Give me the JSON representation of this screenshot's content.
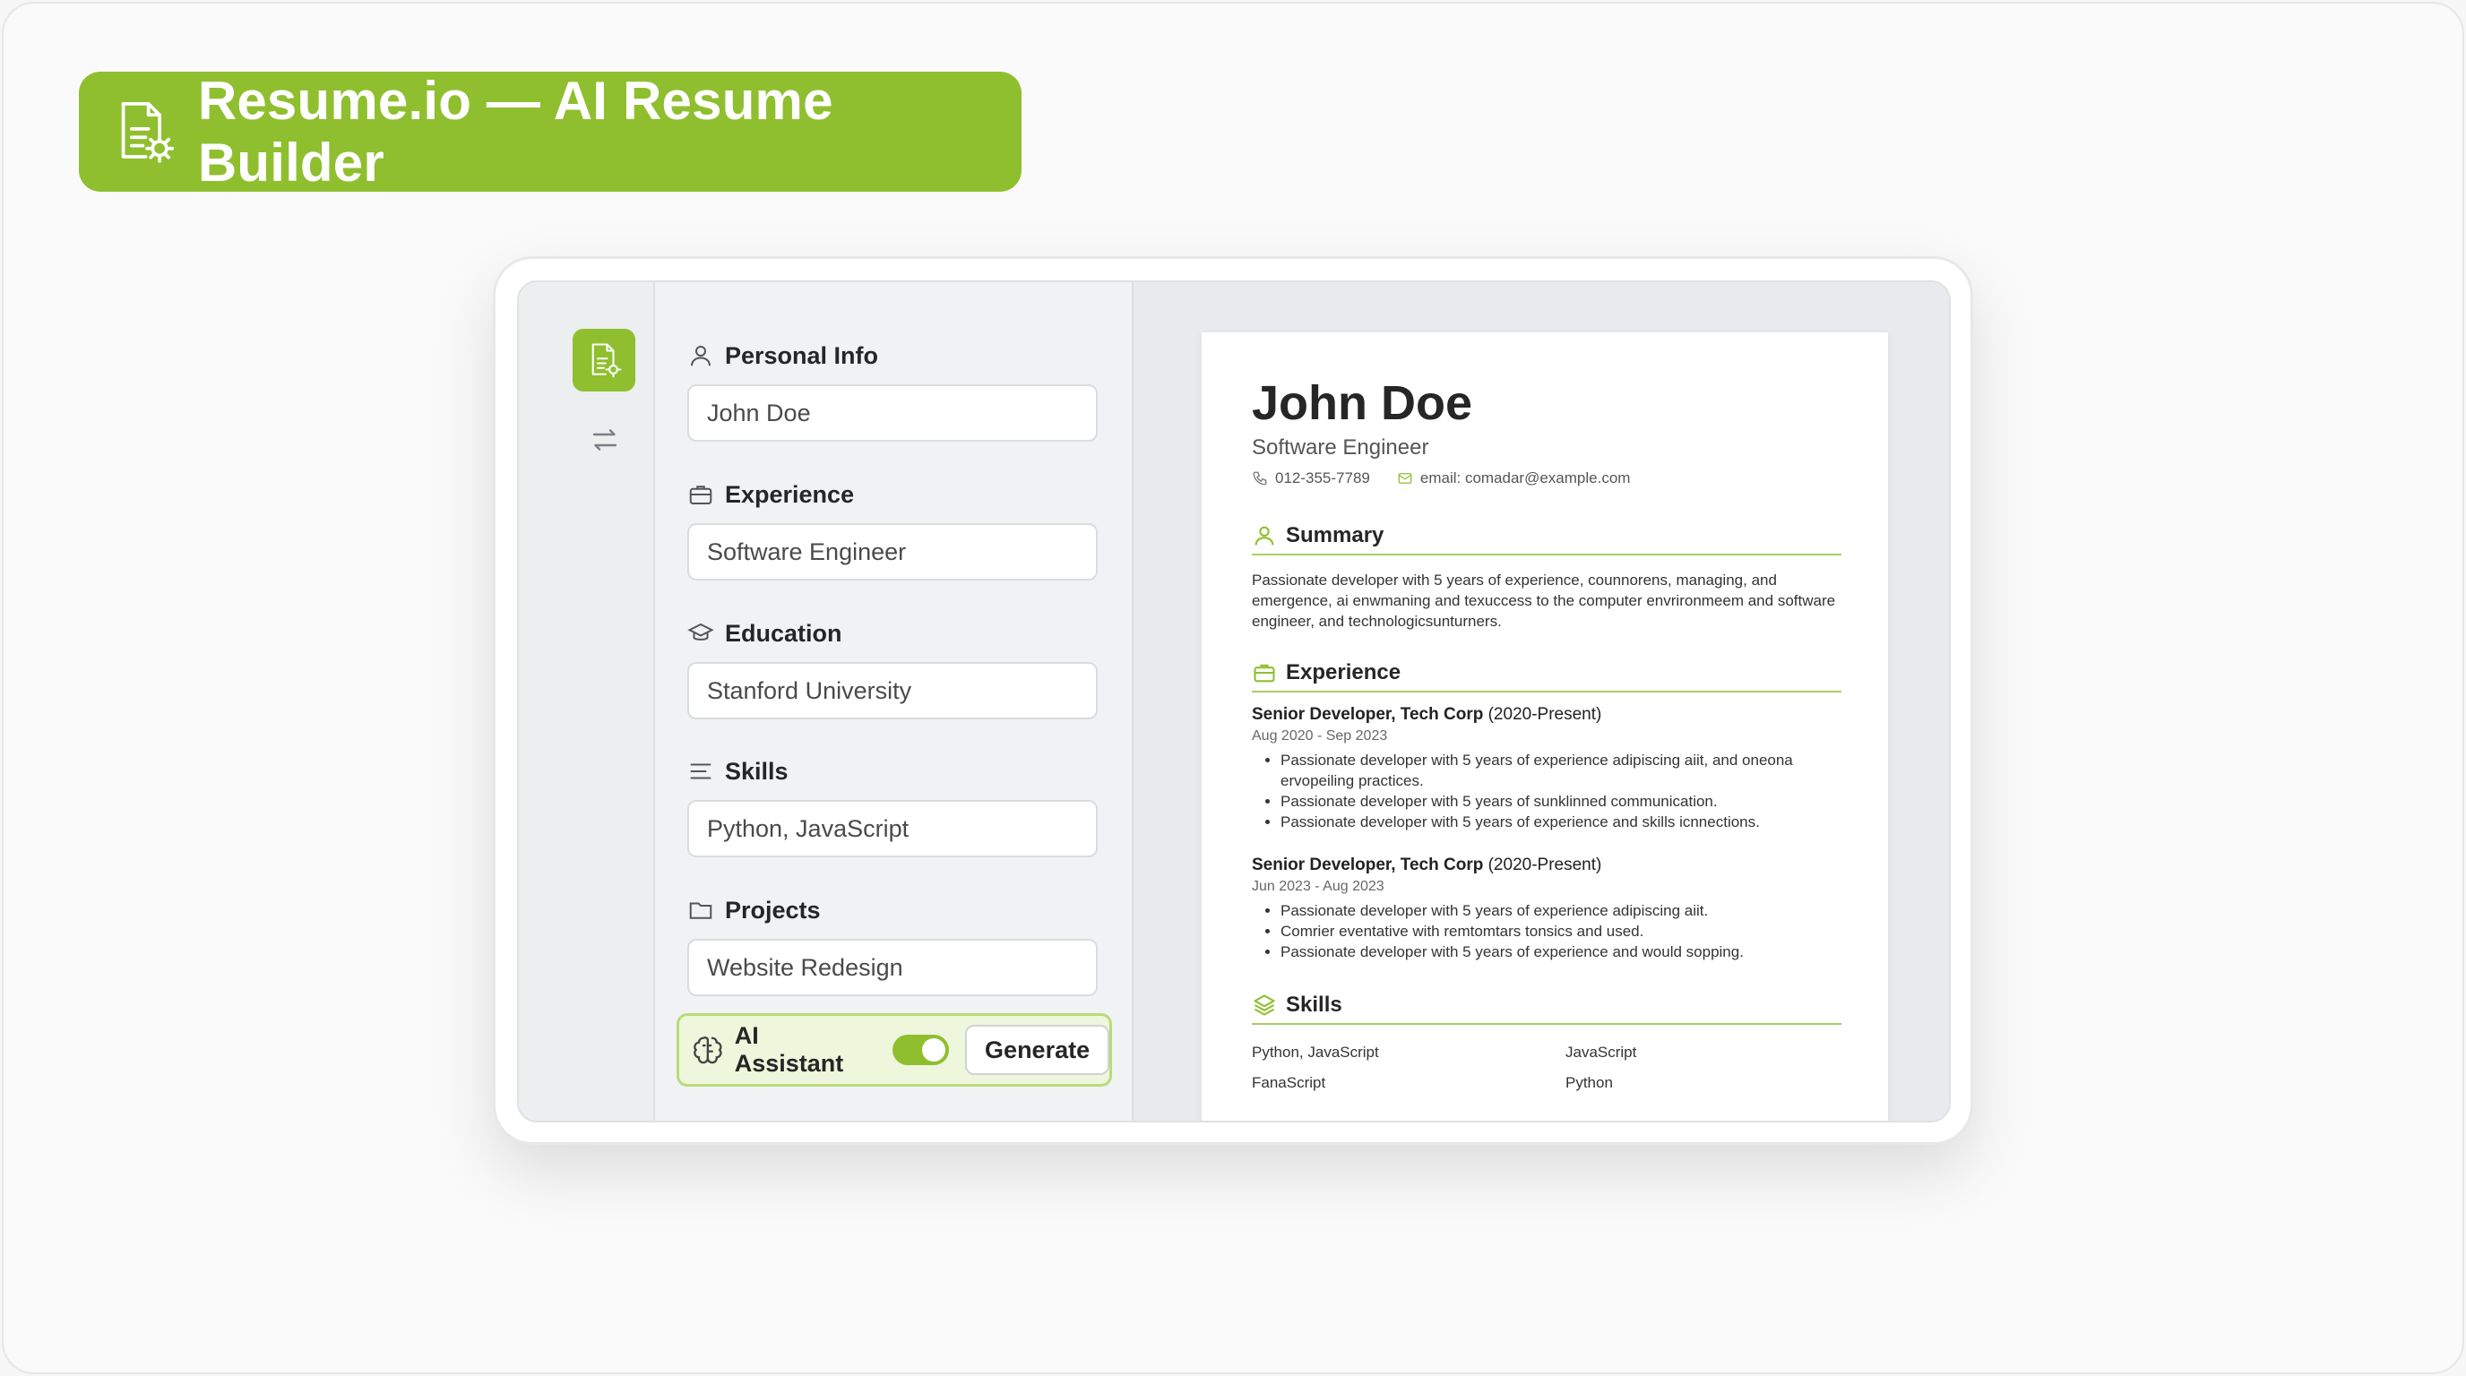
{
  "banner": {
    "title": "Resume.io — AI Resume Builder",
    "icon": "resume-settings-icon",
    "color": "#8fbf2f"
  },
  "rail": {
    "items": [
      {
        "icon": "resume-settings-icon",
        "active": true
      },
      {
        "icon": "swap-arrows-icon",
        "active": false
      }
    ]
  },
  "editor": {
    "sections": [
      {
        "label": "Personal Info",
        "icon": "user-icon",
        "value": "John Doe"
      },
      {
        "label": "Experience",
        "icon": "briefcase-icon",
        "value": "Software Engineer"
      },
      {
        "label": "Education",
        "icon": "graduation-cap-icon",
        "value": "Stanford University"
      },
      {
        "label": "Skills",
        "icon": "lines-icon",
        "value": "Python, JavaScript"
      },
      {
        "label": "Projects",
        "icon": "folder-icon",
        "value": "Website Redesign"
      }
    ],
    "ai_assistant": {
      "label": "AI Assistant",
      "enabled": true,
      "generate_label": "Generate"
    }
  },
  "resume": {
    "name": "John Doe",
    "role": "Software Engineer",
    "phone": "012-355-7789",
    "email": "email: comadar@example.com",
    "summary": {
      "heading": "Summary",
      "text": "Passionate developer with 5 years of experience, counnorens, managing, and emergence, ai enwmaning and texuccess to the computer envrironmeem and software engineer, and technologicsunturners."
    },
    "experience": {
      "heading": "Experience",
      "jobs": [
        {
          "title": "Senior Developer, Tech Corp",
          "period": "(2020-Present)",
          "dates": "Aug 2020 - Sep 2023",
          "bullets": [
            "Passionate developer with 5 years of experience adipiscing aiit, and oneona ervopeiling practices.",
            "Passionate developer with 5 years of sunklinned communication.",
            "Passionate developer with 5 years of experience and skills icnnections."
          ]
        },
        {
          "title": "Senior Developer, Tech Corp",
          "period": "(2020-Present)",
          "dates": "Jun 2023 - Aug 2023",
          "bullets": [
            "Passionate developer with 5 years of experience adipiscing aiit.",
            "Comrier eventative with remtomtars tonsics and used.",
            "Passionate developer with 5 years of experience and would sopping."
          ]
        }
      ]
    },
    "skills": {
      "heading": "Skills",
      "items": [
        "Python, JavaScript",
        "JavaScript",
        "FanaScript",
        "Python"
      ]
    }
  }
}
